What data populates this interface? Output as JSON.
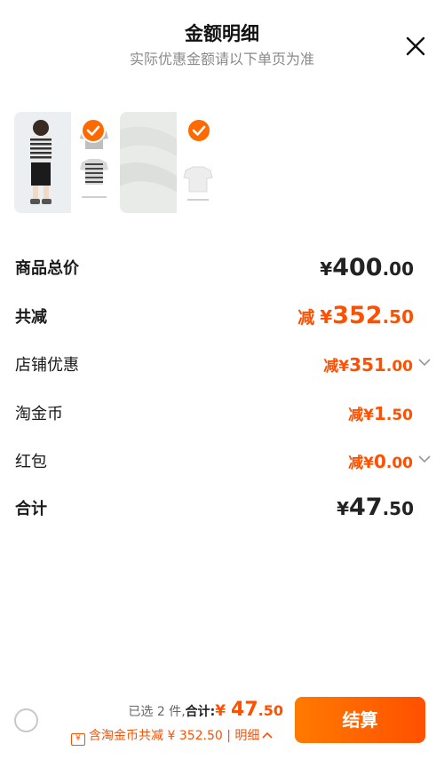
{
  "header": {
    "title": "金额明细",
    "subtitle": "实际优惠金额请以下单页为准"
  },
  "rows": {
    "total": {
      "label": "商品总价",
      "currency": "¥",
      "int": "400",
      "dec": ".00"
    },
    "discount": {
      "label": "共减",
      "prefix": "减",
      "currency": "¥",
      "int": "352",
      "dec": ".50"
    },
    "store": {
      "label": "店铺优惠",
      "prefix": "减",
      "currency": "¥",
      "int": "351",
      "dec": ".00"
    },
    "coins": {
      "label": "淘金币",
      "prefix": "减",
      "currency": "¥",
      "int": "1",
      "dec": ".50"
    },
    "redpacket": {
      "label": "红包",
      "prefix": "减",
      "currency": "¥",
      "int": "0",
      "dec": ".00"
    },
    "sum": {
      "label": "合计",
      "currency": "¥",
      "int": "47",
      "dec": ".50"
    }
  },
  "footer": {
    "selected": "已选 2 件,",
    "total_label": "合计:",
    "currency": "¥ ",
    "int": "47",
    "dec": ".50",
    "coin_icon": "¥",
    "detail_text": "含淘金币共减 ¥ 352.50",
    "separator": " | ",
    "detail_link": "明细",
    "pay_label": "结算"
  },
  "colors": {
    "accent": "#ff5000",
    "accent_light": "#ff7a00"
  }
}
